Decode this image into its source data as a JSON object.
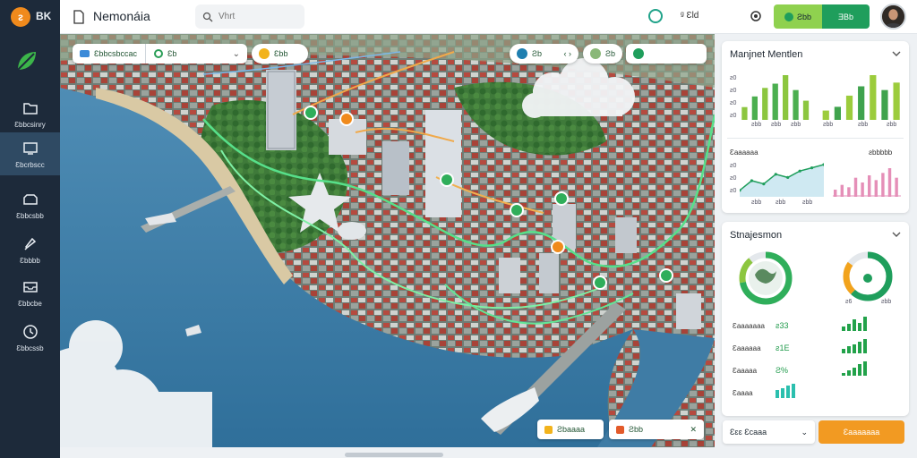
{
  "app": {
    "logo_text": "BK",
    "title": "Nemonáia"
  },
  "search": {
    "placeholder": "Vhrt"
  },
  "header": {
    "locale": "ᵍ Ɛld",
    "btn_a": "Ƨbb",
    "btn_b": "ƎBb",
    "accent_green": "#1f9e5c",
    "accent_lime": "#8fd14f"
  },
  "sidebar": {
    "items": [
      {
        "label": "Ɛbbcsinry",
        "icon": "folder-icon"
      },
      {
        "label": "Ɛbcrbscc",
        "icon": "screen-icon"
      },
      {
        "label": "Ɛbbcsbb",
        "icon": "box-icon"
      },
      {
        "label": "Ɛbbbb",
        "icon": "bell-icon"
      },
      {
        "label": "Ɛbbcbe",
        "icon": "inbox-icon"
      },
      {
        "label": "Ɛbbcssb",
        "icon": "clock-icon"
      }
    ]
  },
  "map_toolbar": {
    "layer": "Ɛbbcsbccac",
    "mode": "Ɛb",
    "filter": "Ɛbb",
    "tool_a": "Ƨb",
    "tool_b": "Ƨb"
  },
  "map_bottom": {
    "btn_a": "Ƨbaaaa",
    "btn_b": "Ƨbb"
  },
  "panel_top": {
    "title": "Manjnet Mentlen",
    "bars_left": [
      12,
      22,
      30,
      34,
      42,
      28,
      18
    ],
    "bars_right": [
      10,
      14,
      26,
      36,
      48,
      32,
      40
    ],
    "ticks_left": [
      "ƨ0",
      "ƨ0",
      "ƨ0",
      "ƨ0",
      "ƨ0"
    ],
    "x_left": [
      "ƨbb",
      "ƨbb",
      "ƨbb"
    ],
    "x_right": [
      "ƨbb",
      "ƨbb",
      "ƨbb"
    ],
    "line_title": "Ɛaaaaaa",
    "line_title_right": "ƨbbbbb",
    "line_ticks": [
      "ƨ0",
      "ƨ0",
      "ƨ0"
    ],
    "line_x": [
      "ƨbb",
      "ƨbb",
      "ƨbb"
    ],
    "line_values": [
      2,
      5,
      4,
      7,
      6,
      8,
      9,
      10
    ],
    "pink_values": [
      3,
      5,
      4,
      8,
      6,
      9,
      7,
      10,
      12,
      8
    ]
  },
  "panel_bottom": {
    "title": "Stnajesmon",
    "gauge_left_pct": 0.72,
    "gauge_right_pct": 0.62,
    "gauge_right_lbl_a": "ƨ6",
    "gauge_right_lbl_b": "ƨbb",
    "stats": [
      {
        "label": "Ɛaaaaaaa",
        "value": "ƨ33",
        "bars": [
          4,
          6,
          10,
          7,
          12
        ]
      },
      {
        "label": "Ɛaaaaaa",
        "value": "ƨ1E",
        "bars": [
          4,
          7,
          9,
          11,
          14
        ]
      },
      {
        "label": "Ɛaaaaa",
        "value": "Ƨ%",
        "bars": [
          3,
          6,
          9,
          13,
          16
        ]
      },
      {
        "label": "Ɛaaaa",
        "value": "",
        "bars": [
          8,
          10,
          12,
          14
        ]
      }
    ]
  },
  "footer": {
    "select_label": "Ɛɛɛ Ɛcaaa",
    "button_label": "Ɛaaaaaaa"
  }
}
